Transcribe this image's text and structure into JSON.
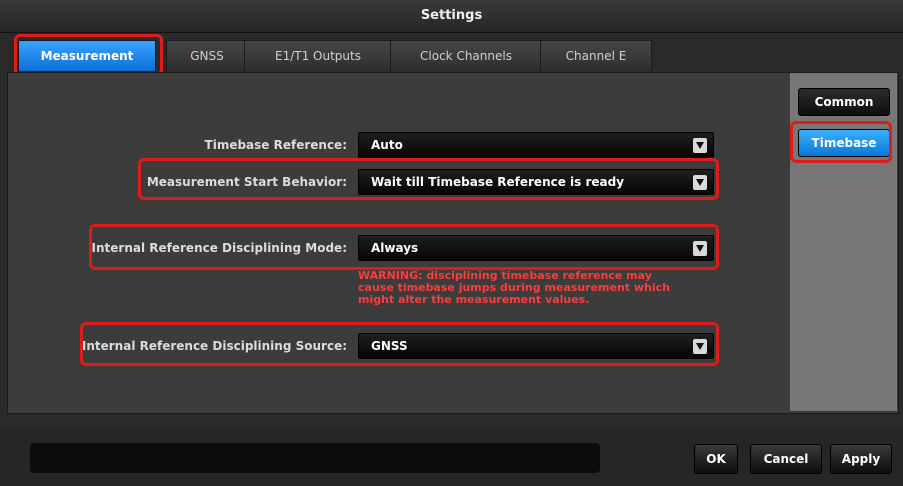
{
  "window": {
    "title": "Settings"
  },
  "tabs": [
    {
      "label": "Measurement",
      "active": true
    },
    {
      "label": "GNSS"
    },
    {
      "label": "E1/T1 Outputs"
    },
    {
      "label": "Clock Channels"
    },
    {
      "label": "Channel E"
    }
  ],
  "sidebar": {
    "common_label": "Common",
    "timebase_label": "Timebase"
  },
  "fields": {
    "timebase_reference": {
      "label": "Timebase Reference:",
      "value": "Auto"
    },
    "measurement_start": {
      "label": "Measurement Start Behavior:",
      "value": "Wait till Timebase Reference is ready"
    },
    "disciplining_mode": {
      "label": "Internal Reference Disciplining Mode:",
      "value": "Always"
    },
    "disciplining_source": {
      "label": "Internal Reference Disciplining Source:",
      "value": "GNSS"
    }
  },
  "warning": {
    "line1": "WARNING: disciplining timebase reference may",
    "line2": "cause timebase jumps during measurement which",
    "line3": "might alter the measurement values."
  },
  "footer": {
    "ok_label": "OK",
    "cancel_label": "Cancel",
    "apply_label": "Apply"
  },
  "colors": {
    "accent": "#1a8cf0",
    "highlight": "#e01b1b",
    "warning": "#ff3b3b"
  }
}
